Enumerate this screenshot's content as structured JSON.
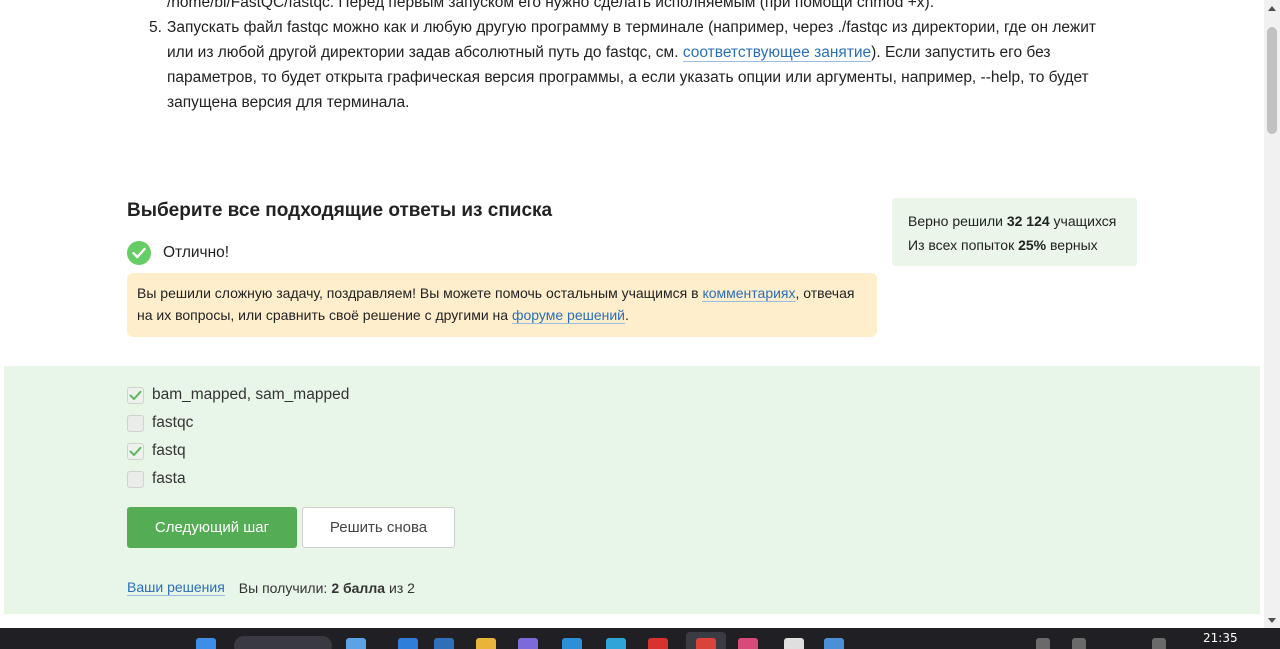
{
  "instructions": {
    "line_a": "/home/bi/FastQC/fastqc. Перед первым запуском его нужно сделать исполняемым (при помощи chmod +x).",
    "item5_number": "5.",
    "item5_part1": "Запускать файл fastqc можно как и любую другую программу в терминале (например, через ./fastqc из директории, где он лежит",
    "item5_part2": "или из любой другой директории задав абсолютный путь до fastqc, см. ",
    "item5_link": "соответствующее занятие",
    "item5_part3": "). Если запустить его без",
    "item5_part4": "параметров, то будет открыта графическая версия программы, а если указать опции или аргументы, например, --help, то будет",
    "item5_part5": "запущена версия для терминала."
  },
  "question": {
    "title": "Выберите все подходящие ответы из списка",
    "status_text": "Отлично!"
  },
  "stats": {
    "solved_prefix": "Верно решили ",
    "solved_count": "32 124",
    "solved_suffix": " учащихся",
    "attempts_prefix": "Из всех попыток ",
    "attempts_percent": "25%",
    "attempts_suffix": " верных"
  },
  "hint": {
    "part1": "Вы решили сложную задачу, поздравляем! Вы можете помочь остальным учащимся в ",
    "link1": "комментариях",
    "part2": ", отвечая",
    "part3": "на их вопросы, или сравнить своё решение с другими на ",
    "link2": "форуме решений",
    "part4": "."
  },
  "options": [
    {
      "label": "bam_mapped, sam_mapped",
      "checked": true
    },
    {
      "label": "fastqc",
      "checked": false
    },
    {
      "label": "fastq",
      "checked": true
    },
    {
      "label": "fasta",
      "checked": false
    }
  ],
  "buttons": {
    "next": "Следующий шаг",
    "retry": "Решить снова"
  },
  "footer": {
    "solutions_link": "Ваши решения",
    "score_prefix": "Вы получили:",
    "score_value": "2 балла",
    "score_suffix": "из 2"
  },
  "taskbar": {
    "clock": "21:35"
  },
  "colors": {
    "accent_green": "#54ad54",
    "answers_bg": "#e8f6e8",
    "hint_bg": "#ffeecc",
    "link": "#2a6ebb"
  }
}
